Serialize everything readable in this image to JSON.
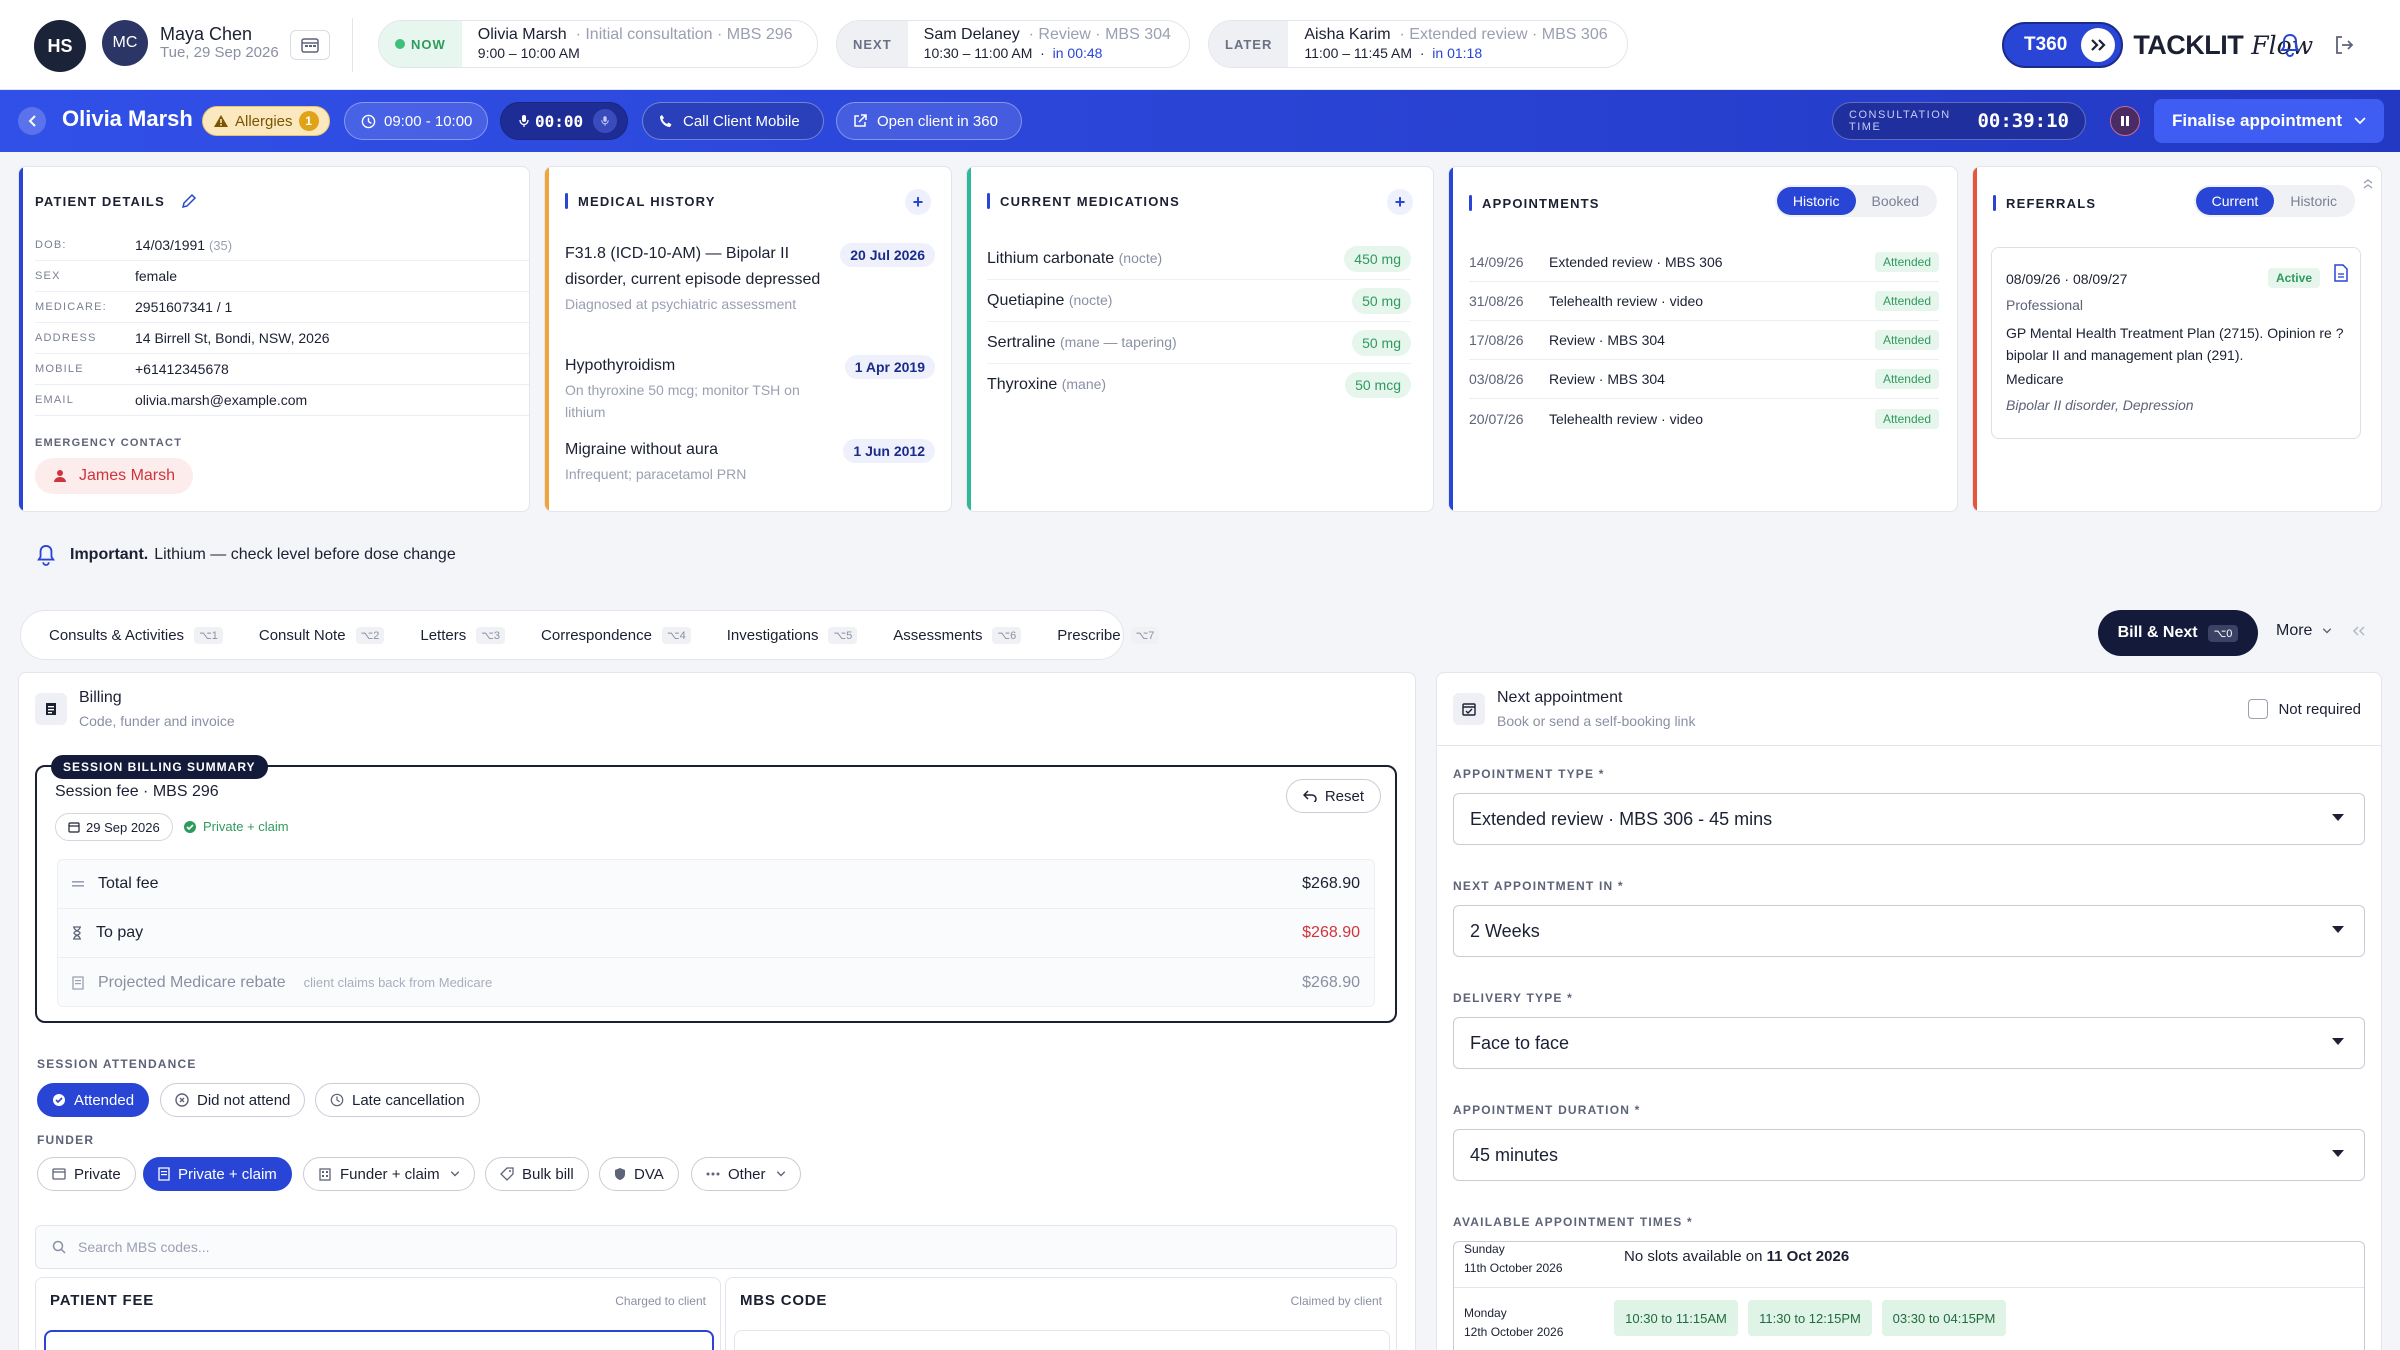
{
  "topbar": {
    "org_initials": "HS",
    "user_initials": "MC",
    "user_name": "Maya Chen",
    "user_date": "Tue, 29 Sep 2026",
    "now": {
      "tag": "NOW",
      "name": "Olivia Marsh",
      "type": "Initial consultation · MBS 296",
      "time": "9:00 – 10:00 AM"
    },
    "next": {
      "tag": "NEXT",
      "name": "Sam Delaney",
      "type": "Review · MBS 304",
      "time": "10:30 – 11:00 AM",
      "eta": "in 00:48"
    },
    "later": {
      "tag": "LATER",
      "name": "Aisha Karim",
      "type": "Extended review · MBS 306",
      "time": "11:00 – 11:45 AM",
      "eta": "in 01:18"
    },
    "brand_badge": "T360",
    "brand_word": "TACKLIT",
    "brand_script": "Flow"
  },
  "header": {
    "patient_name": "Olivia Marsh",
    "allergies_label": "Allergies",
    "allergies_count": "1",
    "time_slot": "09:00 - 10:00",
    "recording_timer": "00:00",
    "call_label": "Call Client Mobile",
    "open360_label": "Open client in 360",
    "consult_time_label": "CONSULTATION TIME",
    "consult_time": "00:39:10",
    "finalise_label": "Finalise appointment"
  },
  "patient_details": {
    "title": "PATIENT DETAILS",
    "rows": [
      {
        "k": "DOB:",
        "v": "14/03/1991",
        "sub": "(35)"
      },
      {
        "k": "SEX",
        "v": "female"
      },
      {
        "k": "MEDICARE:",
        "v": "2951607341 / 1"
      },
      {
        "k": "ADDRESS",
        "v": "14 Birrell St, Bondi, NSW, 2026"
      },
      {
        "k": "MOBILE",
        "v": "+61412345678"
      },
      {
        "k": "EMAIL",
        "v": "olivia.marsh@example.com"
      }
    ],
    "emergency_label": "EMERGENCY CONTACT",
    "emergency_name": "James Marsh"
  },
  "medical_history": {
    "title": "MEDICAL HISTORY",
    "items": [
      {
        "title": "F31.8 (ICD-10-AM) — Bipolar II disorder, current episode depressed",
        "date": "20 Jul 2026",
        "note": "Diagnosed at psychiatric assessment"
      },
      {
        "title": "Hypothyroidism",
        "date": "1 Apr 2019",
        "note": "On thyroxine 50 mcg; monitor TSH on lithium"
      },
      {
        "title": "Migraine without aura",
        "date": "1 Jun 2012",
        "note": "Infrequent; paracetamol PRN"
      }
    ]
  },
  "medications": {
    "title": "CURRENT MEDICATIONS",
    "items": [
      {
        "name": "Lithium carbonate",
        "sched": "(nocte)",
        "dose": "450 mg"
      },
      {
        "name": "Quetiapine",
        "sched": "(nocte)",
        "dose": "50 mg"
      },
      {
        "name": "Sertraline",
        "sched": "(mane — tapering)",
        "dose": "50 mg"
      },
      {
        "name": "Thyroxine",
        "sched": "(mane)",
        "dose": "50 mcg"
      }
    ]
  },
  "appointments": {
    "title": "APPOINTMENTS",
    "seg": [
      "Historic",
      "Booked"
    ],
    "items": [
      {
        "date": "14/09/26",
        "type": "Extended review · MBS 306",
        "status": "Attended"
      },
      {
        "date": "31/08/26",
        "type": "Telehealth review · video",
        "status": "Attended"
      },
      {
        "date": "17/08/26",
        "type": "Review · MBS 304",
        "status": "Attended"
      },
      {
        "date": "03/08/26",
        "type": "Review · MBS 304",
        "status": "Attended"
      },
      {
        "date": "20/07/26",
        "type": "Telehealth review · video",
        "status": "Attended"
      }
    ]
  },
  "referrals": {
    "title": "REFERRALS",
    "seg": [
      "Current",
      "Historic"
    ],
    "dates": "08/09/26 · 08/09/27",
    "status": "Active",
    "kind": "Professional",
    "desc": "GP Mental Health Treatment Plan (2715). Opinion re ?bipolar II and management plan (291).",
    "funder": "Medicare",
    "dx": "Bipolar II disorder, Depression"
  },
  "important": {
    "label": "Important.",
    "text": "Lithium — check level before dose change"
  },
  "tabs": [
    {
      "label": "Consults & Activities",
      "key": "⌥1"
    },
    {
      "label": "Consult Note",
      "key": "⌥2"
    },
    {
      "label": "Letters",
      "key": "⌥3"
    },
    {
      "label": "Correspondence",
      "key": "⌥4"
    },
    {
      "label": "Investigations",
      "key": "⌥5"
    },
    {
      "label": "Assessments",
      "key": "⌥6"
    },
    {
      "label": "Prescribe",
      "key": "⌥7"
    }
  ],
  "bill_next": {
    "label": "Bill & Next",
    "key": "⌥0"
  },
  "more_label": "More",
  "billing": {
    "title": "Billing",
    "subtitle": "Code, funder and invoice",
    "summary_tag": "SESSION BILLING SUMMARY",
    "summary_title": "Session fee · MBS 296",
    "date_chip": "29 Sep 2026",
    "claim_chip": "Private + claim",
    "reset_label": "Reset",
    "rows": [
      {
        "label": "Total fee",
        "amount": "$268.90"
      },
      {
        "label": "To pay",
        "amount": "$268.90"
      },
      {
        "label": "Projected Medicare rebate",
        "note": "client claims back from Medicare",
        "amount": "$268.90"
      }
    ],
    "attendance_label": "SESSION ATTENDANCE",
    "attendance": [
      "Attended",
      "Did not attend",
      "Late cancellation"
    ],
    "funder_label": "FUNDER",
    "funders": [
      "Private",
      "Private + claim",
      "Funder + claim",
      "Bulk bill",
      "DVA",
      "Other"
    ],
    "search_placeholder": "Search MBS codes...",
    "patient_fee": {
      "title": "PATIENT FEE",
      "right": "Charged to client"
    },
    "mbs_code": {
      "title": "MBS CODE",
      "right": "Claimed by client"
    }
  },
  "next_appt": {
    "title": "Next appointment",
    "subtitle": "Book or send a self-booking link",
    "not_required": "Not required",
    "fields": [
      {
        "label": "APPOINTMENT TYPE *",
        "value": "Extended review · MBS 306 - 45 mins"
      },
      {
        "label": "NEXT APPOINTMENT IN *",
        "value": "2 Weeks"
      },
      {
        "label": "DELIVERY TYPE *",
        "value": "Face to face"
      },
      {
        "label": "APPOINTMENT DURATION *",
        "value": "45 minutes"
      }
    ],
    "slots_label": "AVAILABLE APPOINTMENT TIMES *",
    "days": [
      {
        "day": "Sunday",
        "date": "11th October 2026",
        "none_prefix": "No slots available on",
        "none_date": "11 Oct 2026"
      },
      {
        "day": "Monday",
        "date": "12th October 2026",
        "slots": [
          "10:30 to 11:15AM",
          "11:30 to 12:15PM",
          "03:30 to 04:15PM"
        ]
      }
    ]
  }
}
